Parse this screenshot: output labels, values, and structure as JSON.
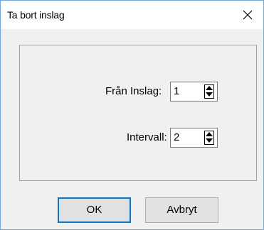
{
  "window": {
    "title": "Ta bort inslag",
    "close_glyph": "close-icon"
  },
  "fields": {
    "from": {
      "label": "Från Inslag:",
      "value": "1"
    },
    "interval": {
      "label": "Intervall:",
      "value": "2"
    }
  },
  "buttons": {
    "ok": "OK",
    "cancel": "Avbryt"
  },
  "colors": {
    "accent": "#0078d7",
    "window_border": "#7aa7d6",
    "dialog_bg": "#f0f0f0",
    "button_bg": "#e1e1e1"
  }
}
